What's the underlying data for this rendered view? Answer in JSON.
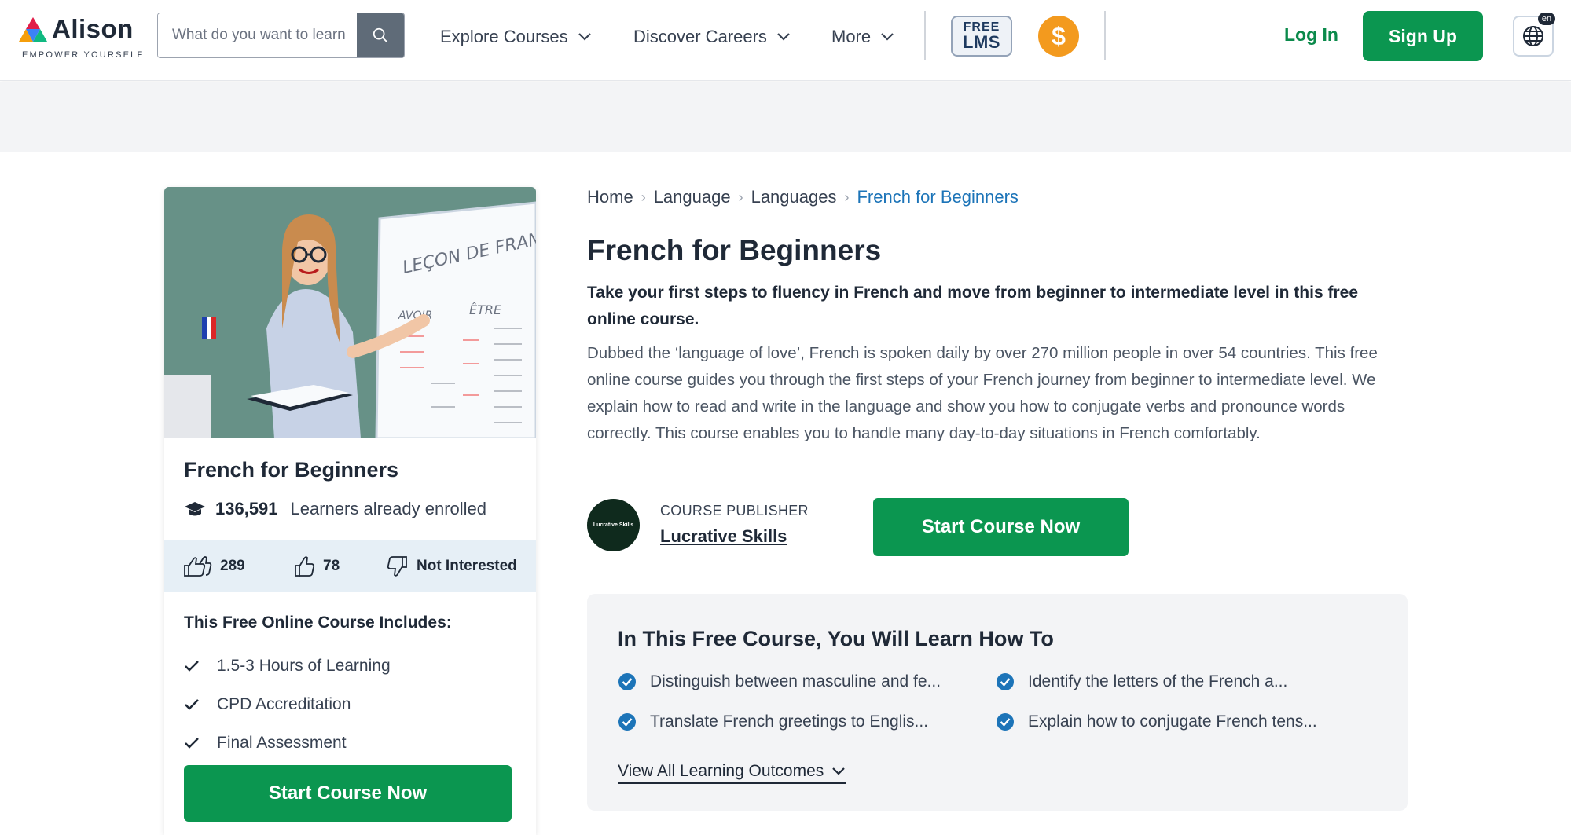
{
  "header": {
    "logo_text": "Alison",
    "logo_tagline": "EMPOWER YOURSELF",
    "search_placeholder": "What do you want to learn",
    "nav": [
      {
        "label": "Explore Courses"
      },
      {
        "label": "Discover Careers"
      },
      {
        "label": "More"
      }
    ],
    "lms_line1": "FREE",
    "lms_line2": "LMS",
    "coin_symbol": "$",
    "login_label": "Log In",
    "signup_label": "Sign Up",
    "lang_badge": "en"
  },
  "card": {
    "title": "French for Beginners",
    "learners_count": "136,591",
    "learners_label": "Learners already enrolled",
    "likes": "289",
    "thumbs": "78",
    "not_interested": "Not Interested",
    "includes_title": "This Free Online Course Includes:",
    "includes": [
      "1.5-3 Hours of Learning",
      "CPD Accreditation",
      "Final Assessment"
    ],
    "cta": "Start Course Now",
    "image_board_title": "LEÇON DE FRANÇAIS",
    "image_board_words": [
      "AVOIR",
      "ÊTRE"
    ]
  },
  "breadcrumb": [
    "Home",
    "Language",
    "Languages",
    "French for Beginners"
  ],
  "course": {
    "title": "French for Beginners",
    "subtitle": "Take your first steps to fluency in French and move from beginner to intermediate level in this free online course.",
    "description": "Dubbed the ‘language of love’, French is spoken daily by over 270 million people in over 54 countries. This free online course guides you through the first steps of your French journey from beginner to intermediate level. We explain how to read and write in the language and show you how to conjugate verbs and pronounce words correctly. This course enables you to handle many day-to-day situations in French comfortably.",
    "publisher_label": "COURSE PUBLISHER",
    "publisher_name": "Lucrative Skills",
    "publisher_logo_text": "Lucrative Skills",
    "cta": "Start Course Now"
  },
  "learn": {
    "title": "In This Free Course, You Will Learn How To",
    "outcomes": [
      "Distinguish between masculine and fe...",
      "Identify the letters of the French a...",
      "Translate French greetings to Englis...",
      "Explain how to conjugate French tens..."
    ],
    "view_all": "View All Learning Outcomes"
  },
  "colors": {
    "brand_green": "#0b9650",
    "link_blue": "#1c74b8",
    "coin_orange": "#f39a1e",
    "check_blue": "#1c74b8"
  }
}
